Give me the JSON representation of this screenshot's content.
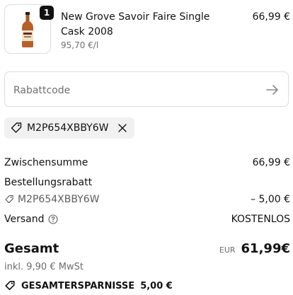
{
  "product": {
    "quantity": "1",
    "name": "New Grove Savoir Faire Single Cask 2008",
    "unit_price": "95,70 €/l",
    "price": "66,99 €"
  },
  "discount": {
    "placeholder": "Rabattcode",
    "applied_code": "M2P654XBBY6W"
  },
  "summary": {
    "subtotal_label": "Zwischensumme",
    "subtotal_value": "66,99 €",
    "order_discount_label": "Bestellungsrabatt",
    "order_discount_code": "M2P654XBBY6W",
    "order_discount_value": "– 5,00 €",
    "shipping_label": "Versand",
    "shipping_value": "KOSTENLOS",
    "total_label": "Gesamt",
    "total_currency": "EUR",
    "total_value": "61,99€",
    "tax_note": "inkl. 9,90 € MwSt",
    "savings_label": "GESAMTERSPARNISSE",
    "savings_value": "5,00 €"
  },
  "icons": {
    "product_image": "whisky-bottle-icon",
    "submit": "arrow-right-icon",
    "tag": "tag-icon",
    "remove": "close-icon",
    "help": "help-circle-icon"
  }
}
